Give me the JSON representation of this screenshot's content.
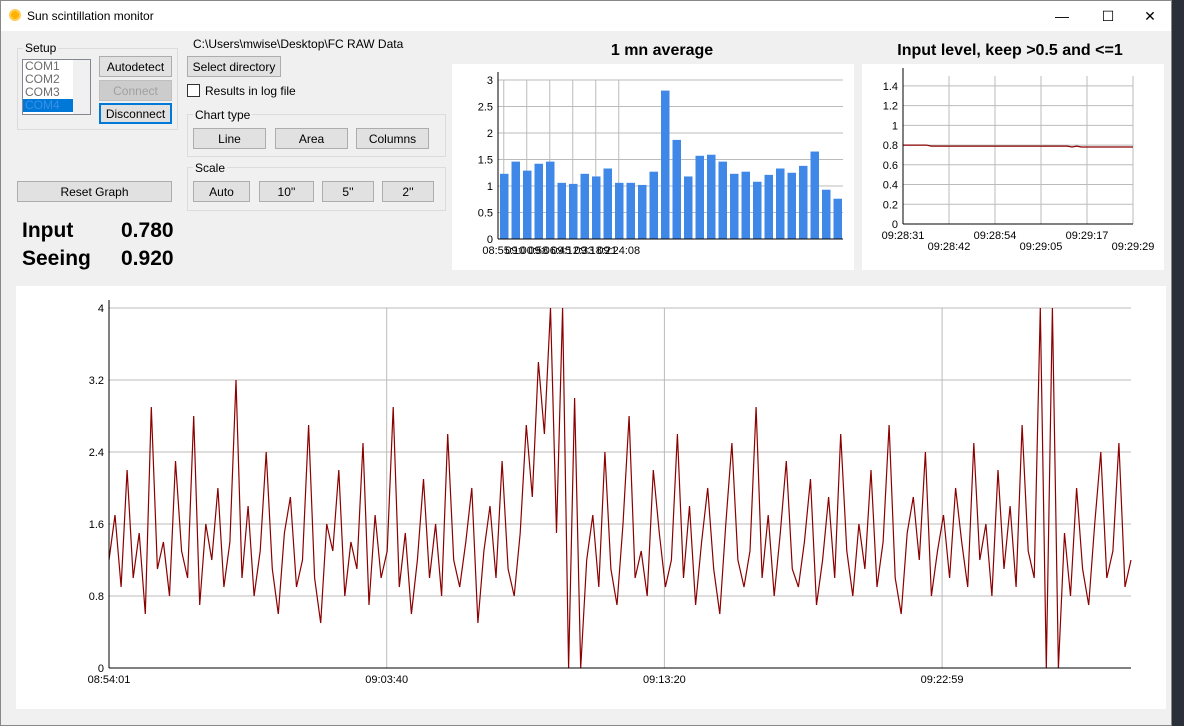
{
  "window": {
    "title": "Sun scintillation monitor",
    "controls": [
      "minimize",
      "maximize",
      "close"
    ]
  },
  "setup": {
    "label": "Setup",
    "ports": [
      "COM1",
      "COM2",
      "COM3",
      "COM4"
    ],
    "selected_port": "COM4",
    "autodetect": "Autodetect",
    "connect": "Connect",
    "disconnect": "Disconnect",
    "reset": "Reset Graph"
  },
  "directory": {
    "path": "C:\\Users\\mwise\\Desktop\\FC RAW Data",
    "select": "Select directory",
    "log_label": "Results in log file",
    "log_checked": false
  },
  "chart_type": {
    "label": "Chart type",
    "options": [
      "Line",
      "Area",
      "Columns"
    ]
  },
  "scale": {
    "label": "Scale",
    "options": [
      "Auto",
      "10''",
      "5''",
      "2''"
    ]
  },
  "readouts": {
    "input_label": "Input",
    "input_value": "0.780",
    "seeing_label": "Seeing",
    "seeing_value": "0.920"
  },
  "chart_data": [
    {
      "type": "bar",
      "title": "1 mn average",
      "color": "#3f88e8",
      "ylim": [
        0,
        3
      ],
      "yticks": [
        "0",
        "0.5",
        "1",
        "1.5",
        "2",
        "2.5",
        "3"
      ],
      "xtick_labels": [
        "08:55:10",
        "09:00:58",
        "09:06:45",
        "09:12:33",
        "09:18:21",
        "09:24:08"
      ],
      "values": [
        1.23,
        1.46,
        1.29,
        1.42,
        1.46,
        1.06,
        1.04,
        1.23,
        1.18,
        1.33,
        1.06,
        1.06,
        1.02,
        1.27,
        2.8,
        1.87,
        1.18,
        1.57,
        1.59,
        1.46,
        1.23,
        1.27,
        1.08,
        1.21,
        1.33,
        1.25,
        1.38,
        1.65,
        0.93,
        0.76
      ]
    },
    {
      "type": "line",
      "title": "Input level, keep >0.5 and <=1",
      "color": "#8b0000",
      "ylim": [
        0,
        1.5
      ],
      "yticks": [
        "0",
        "0.2",
        "0.4",
        "0.6",
        "0.8",
        "1",
        "1.2",
        "1.4"
      ],
      "xtick_labels": [
        "09:28:31",
        "09:28:42",
        "09:28:54",
        "09:29:05",
        "09:29:17",
        "09:29:29"
      ],
      "values": [
        0.8,
        0.8,
        0.8,
        0.8,
        0.8,
        0.8,
        0.79,
        0.79,
        0.79,
        0.79,
        0.79,
        0.79,
        0.79,
        0.79,
        0.79,
        0.79,
        0.79,
        0.79,
        0.79,
        0.79,
        0.79,
        0.79,
        0.79,
        0.79,
        0.79,
        0.79,
        0.79,
        0.79,
        0.79,
        0.79,
        0.79,
        0.79,
        0.79,
        0.79,
        0.79,
        0.79,
        0.78,
        0.79,
        0.78,
        0.78,
        0.78,
        0.78,
        0.78,
        0.78,
        0.78,
        0.78,
        0.78,
        0.78,
        0.78,
        0.78
      ]
    },
    {
      "type": "line",
      "title": "",
      "color": "#8b0000",
      "ylim": [
        0,
        4
      ],
      "yticks": [
        "0",
        "0.8",
        "1.6",
        "2.4",
        "3.2",
        "4"
      ],
      "xtick_labels": [
        "08:54:01",
        "09:03:40",
        "09:13:20",
        "09:22:59"
      ],
      "values": [
        1.2,
        1.7,
        0.9,
        2.2,
        1.0,
        1.5,
        0.6,
        2.9,
        1.1,
        1.4,
        0.8,
        2.3,
        1.3,
        1.0,
        2.8,
        0.7,
        1.6,
        1.2,
        2.0,
        0.9,
        1.4,
        3.2,
        1.0,
        1.8,
        0.8,
        1.3,
        2.4,
        1.1,
        0.6,
        1.5,
        1.9,
        0.9,
        1.2,
        2.7,
        1.0,
        0.5,
        1.6,
        1.3,
        2.2,
        0.8,
        1.4,
        1.1,
        2.5,
        0.7,
        1.7,
        1.0,
        1.3,
        2.9,
        0.9,
        1.5,
        0.6,
        1.2,
        2.1,
        1.0,
        1.6,
        0.8,
        2.6,
        1.2,
        0.9,
        1.4,
        2.0,
        0.5,
        1.3,
        1.8,
        1.0,
        2.3,
        1.1,
        0.8,
        1.5,
        2.7,
        1.9,
        3.4,
        2.6,
        4.0,
        1.5,
        4.0,
        0.0,
        3.0,
        0.0,
        1.2,
        1.7,
        0.9,
        2.4,
        1.1,
        0.7,
        1.6,
        2.8,
        1.0,
        1.3,
        0.8,
        2.2,
        1.5,
        0.9,
        1.2,
        2.6,
        1.0,
        1.8,
        0.7,
        1.4,
        2.0,
        1.1,
        0.6,
        1.6,
        2.5,
        1.2,
        0.9,
        1.3,
        2.9,
        1.0,
        1.7,
        0.8,
        1.5,
        2.3,
        1.1,
        0.9,
        1.4,
        2.1,
        0.7,
        1.2,
        1.9,
        1.0,
        2.6,
        1.3,
        0.8,
        1.6,
        1.1,
        2.2,
        0.9,
        1.4,
        2.7,
        1.0,
        0.6,
        1.5,
        1.9,
        1.2,
        2.4,
        0.8,
        1.3,
        1.7,
        1.0,
        2.0,
        1.4,
        0.9,
        2.5,
        1.2,
        1.6,
        0.8,
        2.2,
        1.1,
        1.8,
        0.9,
        2.7,
        1.3,
        1.0,
        4.0,
        0.0,
        4.0,
        0.0,
        1.5,
        0.8,
        2.0,
        1.1,
        0.7,
        1.6,
        2.4,
        1.0,
        1.3,
        2.5,
        0.9,
        1.2
      ]
    }
  ]
}
